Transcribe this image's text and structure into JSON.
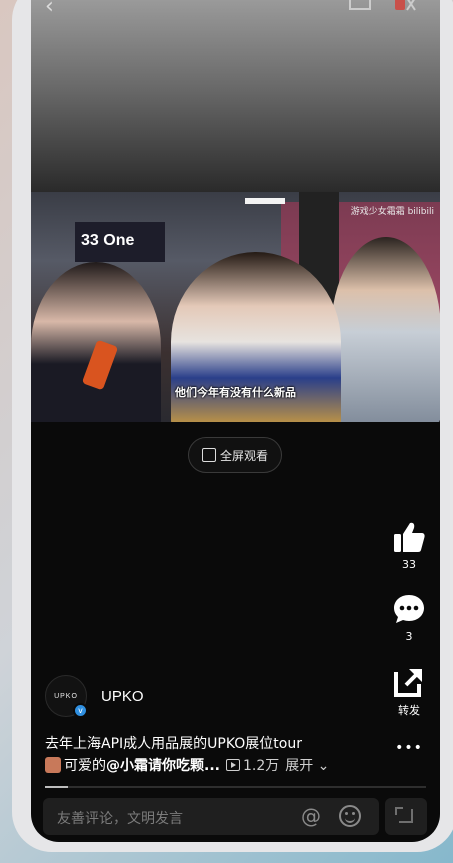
{
  "video": {
    "subtitle": "他们今年有没有什么新品",
    "watermark": "游戏少女霜霜 bilibili",
    "banner": "33 One"
  },
  "fullscreen_label": "全屏观看",
  "actions": {
    "like_count": "33",
    "comment_count": "3",
    "share_label": "转发",
    "more_label": "•••"
  },
  "author": {
    "name": "UPKO",
    "avatar_text": "UPKO",
    "verified_mark": "v"
  },
  "description": {
    "title": "去年上海API成人用品展的UPKO展位tour",
    "text": "可爱的",
    "mention": "@小霜请你吃颗...",
    "views": "1.2万",
    "expand": "展开"
  },
  "progress": 0.06,
  "comment_input": {
    "placeholder": "友善评论，文明发言",
    "at_symbol": "@"
  },
  "colors": {
    "accent": "#2f8fe0",
    "screen_bg": "#0a0a0a"
  }
}
